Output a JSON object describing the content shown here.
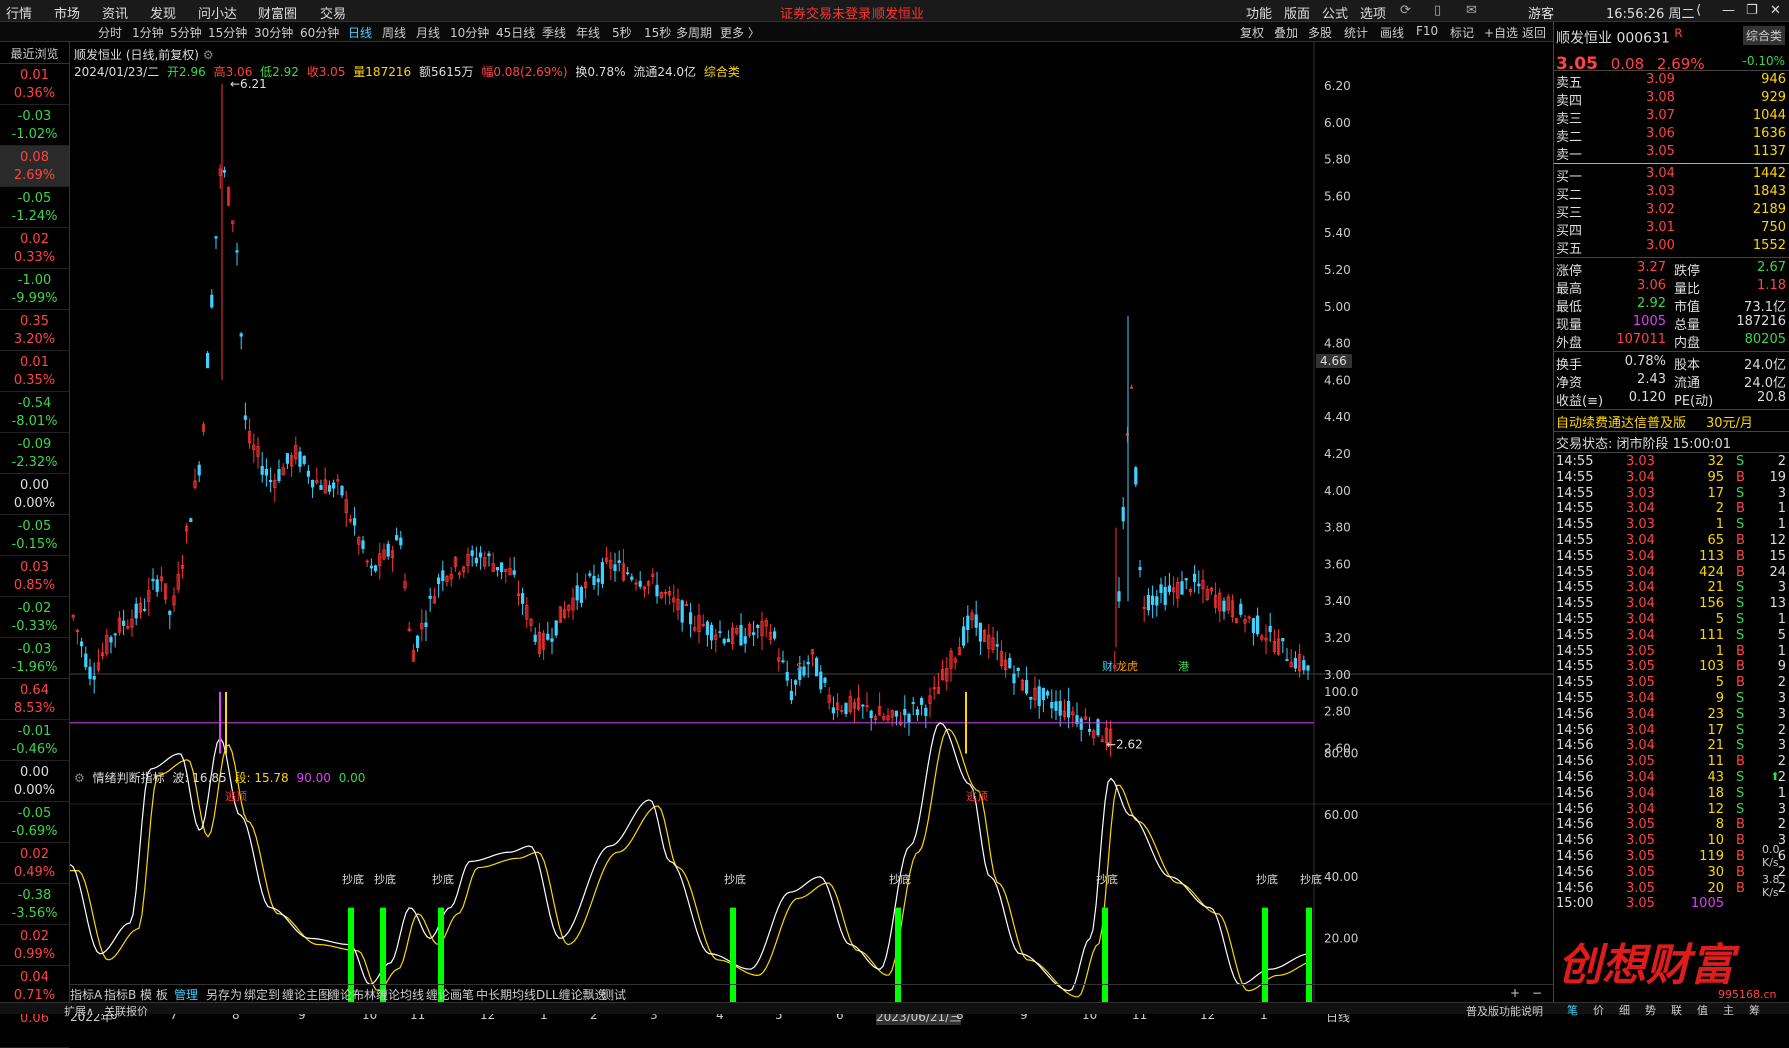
{
  "top_menu": {
    "items": [
      "行情",
      "市场",
      "资讯",
      "发现",
      "问小达",
      "财富圈",
      "交易"
    ],
    "alert": "证券交易未登录",
    "stock_name_alert": "顺发恒业",
    "right_items": [
      "功能",
      "版面",
      "公式",
      "选项"
    ],
    "user": "游客",
    "clock": "16:56:26 周二"
  },
  "toolbar": {
    "periods": [
      "分时",
      "1分钟",
      "5分钟",
      "15分钟",
      "30分钟",
      "60分钟",
      "日线",
      "周线",
      "月线",
      "10分钟",
      "45日线",
      "季线",
      "年线",
      "5秒",
      "15秒",
      "多周期",
      "更多 〉"
    ],
    "active_period": "日线",
    "right_buttons": [
      "复权",
      "叠加",
      "多股",
      "统计",
      "画线",
      "F10",
      "标记",
      "+自选",
      "返回"
    ]
  },
  "left_panel": {
    "header": "最近浏览",
    "rows": [
      {
        "a": "0.01",
        "b": "0.36%",
        "c": "red"
      },
      {
        "a": "-0.03",
        "b": "-1.02%",
        "c": "green"
      },
      {
        "a": "0.08",
        "b": "2.69%",
        "c": "red"
      },
      {
        "a": "-0.05",
        "b": "-1.24%",
        "c": "green"
      },
      {
        "a": "0.02",
        "b": "0.33%",
        "c": "red"
      },
      {
        "a": "-1.00",
        "b": "-9.99%",
        "c": "green"
      },
      {
        "a": "0.35",
        "b": "3.20%",
        "c": "red"
      },
      {
        "a": "0.01",
        "b": "0.35%",
        "c": "red"
      },
      {
        "a": "-0.54",
        "b": "-8.01%",
        "c": "green"
      },
      {
        "a": "-0.09",
        "b": "-2.32%",
        "c": "green"
      },
      {
        "a": "0.00",
        "b": "0.00%",
        "c": "white"
      },
      {
        "a": "-0.05",
        "b": "-0.15%",
        "c": "green"
      },
      {
        "a": "0.03",
        "b": "0.85%",
        "c": "red"
      },
      {
        "a": "-0.02",
        "b": "-0.33%",
        "c": "green"
      },
      {
        "a": "-0.03",
        "b": "-1.96%",
        "c": "green"
      },
      {
        "a": "0.64",
        "b": "8.53%",
        "c": "red"
      },
      {
        "a": "-0.01",
        "b": "-0.46%",
        "c": "green"
      },
      {
        "a": "0.00",
        "b": "0.00%",
        "c": "white"
      },
      {
        "a": "-0.05",
        "b": "-0.69%",
        "c": "green"
      },
      {
        "a": "0.02",
        "b": "0.49%",
        "c": "red"
      },
      {
        "a": "-0.38",
        "b": "-3.56%",
        "c": "green"
      },
      {
        "a": "0.02",
        "b": "0.99%",
        "c": "red"
      },
      {
        "a": "0.04",
        "b": "0.71%",
        "c": "red"
      },
      {
        "a": "0.06",
        "b": "",
        "c": "red"
      }
    ]
  },
  "chart": {
    "title": "顺发恒业 (日线,前复权)",
    "info_date": "2024/01/23/二",
    "open": "开2.96",
    "high": "高3.06",
    "low": "低2.92",
    "close": "收3.05",
    "volume": "量187216",
    "amount": "额5615万",
    "change": "幅0.08(2.69%)",
    "turnover": "换0.78%",
    "float": "流通24.0亿",
    "category": "综合类",
    "high_mark": "6.21",
    "low_mark": "2.62",
    "current_price_tag": "4.66",
    "price_axis": [
      "6.20",
      "6.00",
      "5.80",
      "5.60",
      "5.40",
      "5.20",
      "5.00",
      "4.80",
      "4.60",
      "4.40",
      "4.20",
      "4.00",
      "3.80",
      "3.60",
      "3.40",
      "3.20",
      "3.00",
      "2.80",
      "2.60"
    ],
    "markers": {
      "s": "$",
      "cai": "财",
      "bang": "龙虎",
      "gang": "港"
    }
  },
  "indicator": {
    "name": "情绪判断指标",
    "bo": "波: 16.85",
    "duan": "段: 15.78",
    "v1": "90.00",
    "v2": "0.00",
    "axis": [
      "100.0",
      "80.00",
      "60.00",
      "40.00",
      "20.00"
    ],
    "buy_label": "抄底",
    "top_label": "逃顶"
  },
  "date_axis": {
    "labels": [
      "2022年",
      "6",
      "7",
      "8",
      "9",
      "10",
      "11",
      "12",
      "1",
      "2",
      "3",
      "4",
      "5",
      "6",
      "2023/06/21/三",
      "8",
      "9",
      "10",
      "11",
      "12",
      "1",
      "日线"
    ]
  },
  "bottom_tabs": {
    "items": [
      "指标A",
      "指标B",
      "模 板",
      "管理",
      "另存为",
      "绑定到",
      "缠论主图",
      "缠论布林",
      "缠论均线",
      "缠论画笔",
      "中长期均线",
      "DLL缠论飘逸",
      "测试"
    ],
    "active": "管理",
    "extra": [
      "扩展∧",
      "关联报价"
    ],
    "right_note": "普及版功能说明"
  },
  "right_panel": {
    "name": "顺发恒业",
    "code": "000631",
    "r_mark": "R",
    "tag1": "综合类",
    "price": "3.05",
    "change": "0.08",
    "pct": "2.69%",
    "tag2": "-0.10%",
    "asks": [
      {
        "label": "卖五",
        "price": "3.09",
        "vol": "946"
      },
      {
        "label": "卖四",
        "price": "3.08",
        "vol": "929"
      },
      {
        "label": "卖三",
        "price": "3.07",
        "vol": "1044"
      },
      {
        "label": "卖二",
        "price": "3.06",
        "vol": "1636"
      },
      {
        "label": "卖一",
        "price": "3.05",
        "vol": "1137"
      }
    ],
    "bids": [
      {
        "label": "买一",
        "price": "3.04",
        "vol": "1442"
      },
      {
        "label": "买二",
        "price": "3.03",
        "vol": "1843"
      },
      {
        "label": "买三",
        "price": "3.02",
        "vol": "2189"
      },
      {
        "label": "买四",
        "price": "3.01",
        "vol": "750"
      },
      {
        "label": "买五",
        "price": "3.00",
        "vol": "1552"
      }
    ],
    "stats": [
      {
        "l1": "涨停",
        "v1": "3.27",
        "c1": "red",
        "l2": "跌停",
        "v2": "2.67",
        "c2": "green"
      },
      {
        "l1": "最高",
        "v1": "3.06",
        "c1": "red",
        "l2": "量比",
        "v2": "1.18",
        "c2": "red"
      },
      {
        "l1": "最低",
        "v1": "2.92",
        "c1": "green",
        "l2": "市值",
        "v2": "73.1亿",
        "c2": "white"
      },
      {
        "l1": "现量",
        "v1": "1005",
        "c1": "magenta",
        "l2": "总量",
        "v2": "187216",
        "c2": "white"
      },
      {
        "l1": "外盘",
        "v1": "107011",
        "c1": "red",
        "l2": "内盘",
        "v2": "80205",
        "c2": "green"
      }
    ],
    "stats2": [
      {
        "l1": "换手",
        "v1": "0.78%",
        "l2": "股本",
        "v2": "24.0亿"
      },
      {
        "l1": "净资",
        "v1": "2.43",
        "l2": "流通",
        "v2": "24.0亿"
      },
      {
        "l1": "收益(≡)",
        "v1": "0.120",
        "l2": "PE(动)",
        "v2": "20.8"
      }
    ],
    "promo": "自动续费通达信普及版",
    "promo_price": "30元/月",
    "trade_status": "交易状态: 闭市阶段 15:00:01",
    "ticks": [
      [
        "14:55",
        "3.03",
        "32",
        "S",
        "2"
      ],
      [
        "14:55",
        "3.04",
        "95",
        "B",
        "19"
      ],
      [
        "14:55",
        "3.03",
        "17",
        "S",
        "3"
      ],
      [
        "14:55",
        "3.04",
        "2",
        "B",
        "1"
      ],
      [
        "14:55",
        "3.03",
        "1",
        "S",
        "1"
      ],
      [
        "14:55",
        "3.04",
        "65",
        "B",
        "12"
      ],
      [
        "14:55",
        "3.04",
        "113",
        "B",
        "15"
      ],
      [
        "14:55",
        "3.04",
        "424",
        "B",
        "24"
      ],
      [
        "14:55",
        "3.04",
        "21",
        "S",
        "3"
      ],
      [
        "14:55",
        "3.04",
        "156",
        "S",
        "13"
      ],
      [
        "14:55",
        "3.04",
        "5",
        "S",
        "1"
      ],
      [
        "14:55",
        "3.04",
        "111",
        "S",
        "5"
      ],
      [
        "14:55",
        "3.05",
        "1",
        "B",
        "1"
      ],
      [
        "14:55",
        "3.05",
        "103",
        "B",
        "9"
      ],
      [
        "14:55",
        "3.05",
        "5",
        "B",
        "2"
      ],
      [
        "14:55",
        "3.04",
        "9",
        "S",
        "3"
      ],
      [
        "14:56",
        "3.04",
        "23",
        "S",
        "3"
      ],
      [
        "14:56",
        "3.04",
        "17",
        "S",
        "2"
      ],
      [
        "14:56",
        "3.04",
        "21",
        "S",
        "3"
      ],
      [
        "14:56",
        "3.05",
        "11",
        "B",
        "2"
      ],
      [
        "14:56",
        "3.04",
        "43",
        "S",
        "2"
      ],
      [
        "14:56",
        "3.04",
        "18",
        "S",
        "1"
      ],
      [
        "14:56",
        "3.04",
        "12",
        "S",
        "3"
      ],
      [
        "14:56",
        "3.05",
        "8",
        "B",
        "2"
      ],
      [
        "14:56",
        "3.05",
        "10",
        "B",
        "3"
      ],
      [
        "14:56",
        "3.05",
        "119",
        "B",
        "6"
      ],
      [
        "14:56",
        "3.05",
        "30",
        "B",
        "2"
      ],
      [
        "14:56",
        "3.05",
        "20",
        "B",
        "2"
      ],
      [
        "15:00",
        "3.05",
        "1005",
        "",
        ""
      ]
    ],
    "bottom_tabs": [
      "笔",
      "价",
      "细",
      "势",
      "联",
      "值",
      "主",
      "筹"
    ],
    "side_values": {
      "a": "0.0",
      "b": "K/s",
      "c": "3.8",
      "d": "K/s"
    }
  },
  "logo": {
    "text": "创想财富",
    "url_text": "995168.cn"
  }
}
